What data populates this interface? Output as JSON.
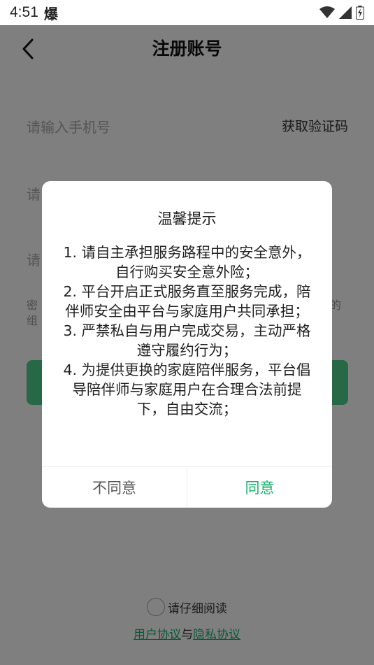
{
  "status_bar": {
    "time": "4:51",
    "notification": "爆"
  },
  "header": {
    "title": "注册账号"
  },
  "form": {
    "phone_placeholder": "请输入手机号",
    "get_code_label": "获取验证码",
    "code_placeholder_partial": "请",
    "password_placeholder_partial": "请",
    "password_hint_partial_line1": "密",
    "password_hint_partial_line2": "组",
    "password_hint_right": "的"
  },
  "agreement": {
    "read_label": "请仔细阅读",
    "user_agreement": "用户协议",
    "and_text": "与",
    "privacy_policy": "隐私协议"
  },
  "dialog": {
    "title": "温馨提示",
    "items": [
      "1. 请自主承担服务路程中的安全意外，自行购买安全意外险；",
      "2. 平台开启正式服务直至服务完成，陪伴师安全由平台与家庭用户共同承担；",
      "3. 严禁私自与用户完成交易，主动严格遵守履约行为；",
      "4. 为提供更换的家庭陪伴服务，平台倡导陪伴师与家庭用户在合理合法前提下，自由交流；"
    ],
    "disagree_label": "不同意",
    "agree_label": "同意"
  },
  "colors": {
    "accent": "#13b36b",
    "button_green": "#4fd18f",
    "overlay": "rgba(0,0,0,0.5)"
  }
}
